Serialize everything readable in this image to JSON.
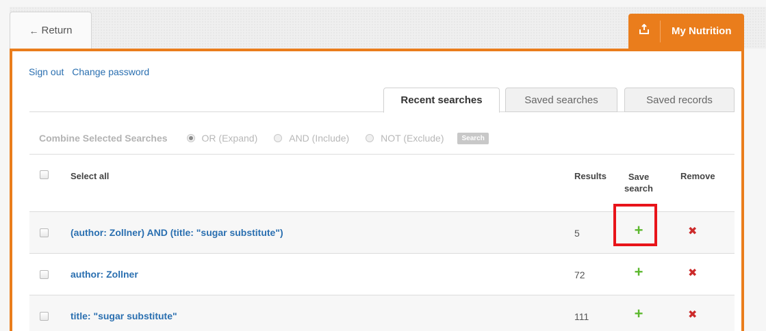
{
  "nav": {
    "return_label": "Return",
    "my_nutrition_label": "My Nutrition"
  },
  "account": {
    "sign_out": "Sign out",
    "change_password": "Change password"
  },
  "tabs": [
    {
      "label": "Recent searches",
      "active": true
    },
    {
      "label": "Saved searches",
      "active": false
    },
    {
      "label": "Saved records",
      "active": false
    }
  ],
  "combine": {
    "label": "Combine Selected Searches",
    "options": [
      {
        "label": "OR (Expand)",
        "checked": true
      },
      {
        "label": "AND (Include)",
        "checked": false
      },
      {
        "label": "NOT (Exclude)",
        "checked": false
      }
    ],
    "button_label": "Search"
  },
  "table": {
    "headers": {
      "select_all": "Select all",
      "results": "Results",
      "save_search": "Save search",
      "remove": "Remove"
    },
    "rows": [
      {
        "query": "(author: Zollner) AND (title: \"sugar substitute\")",
        "results": "5"
      },
      {
        "query": "author: Zollner",
        "results": "72"
      },
      {
        "query": "title: \"sugar substitute\"",
        "results": "111"
      }
    ]
  },
  "colors": {
    "accent_orange": "#ea7d1c",
    "link_blue": "#2a6fb0",
    "add_green": "#5cb82e",
    "remove_red": "#cc2b2b",
    "highlight_red": "#e8141a"
  }
}
